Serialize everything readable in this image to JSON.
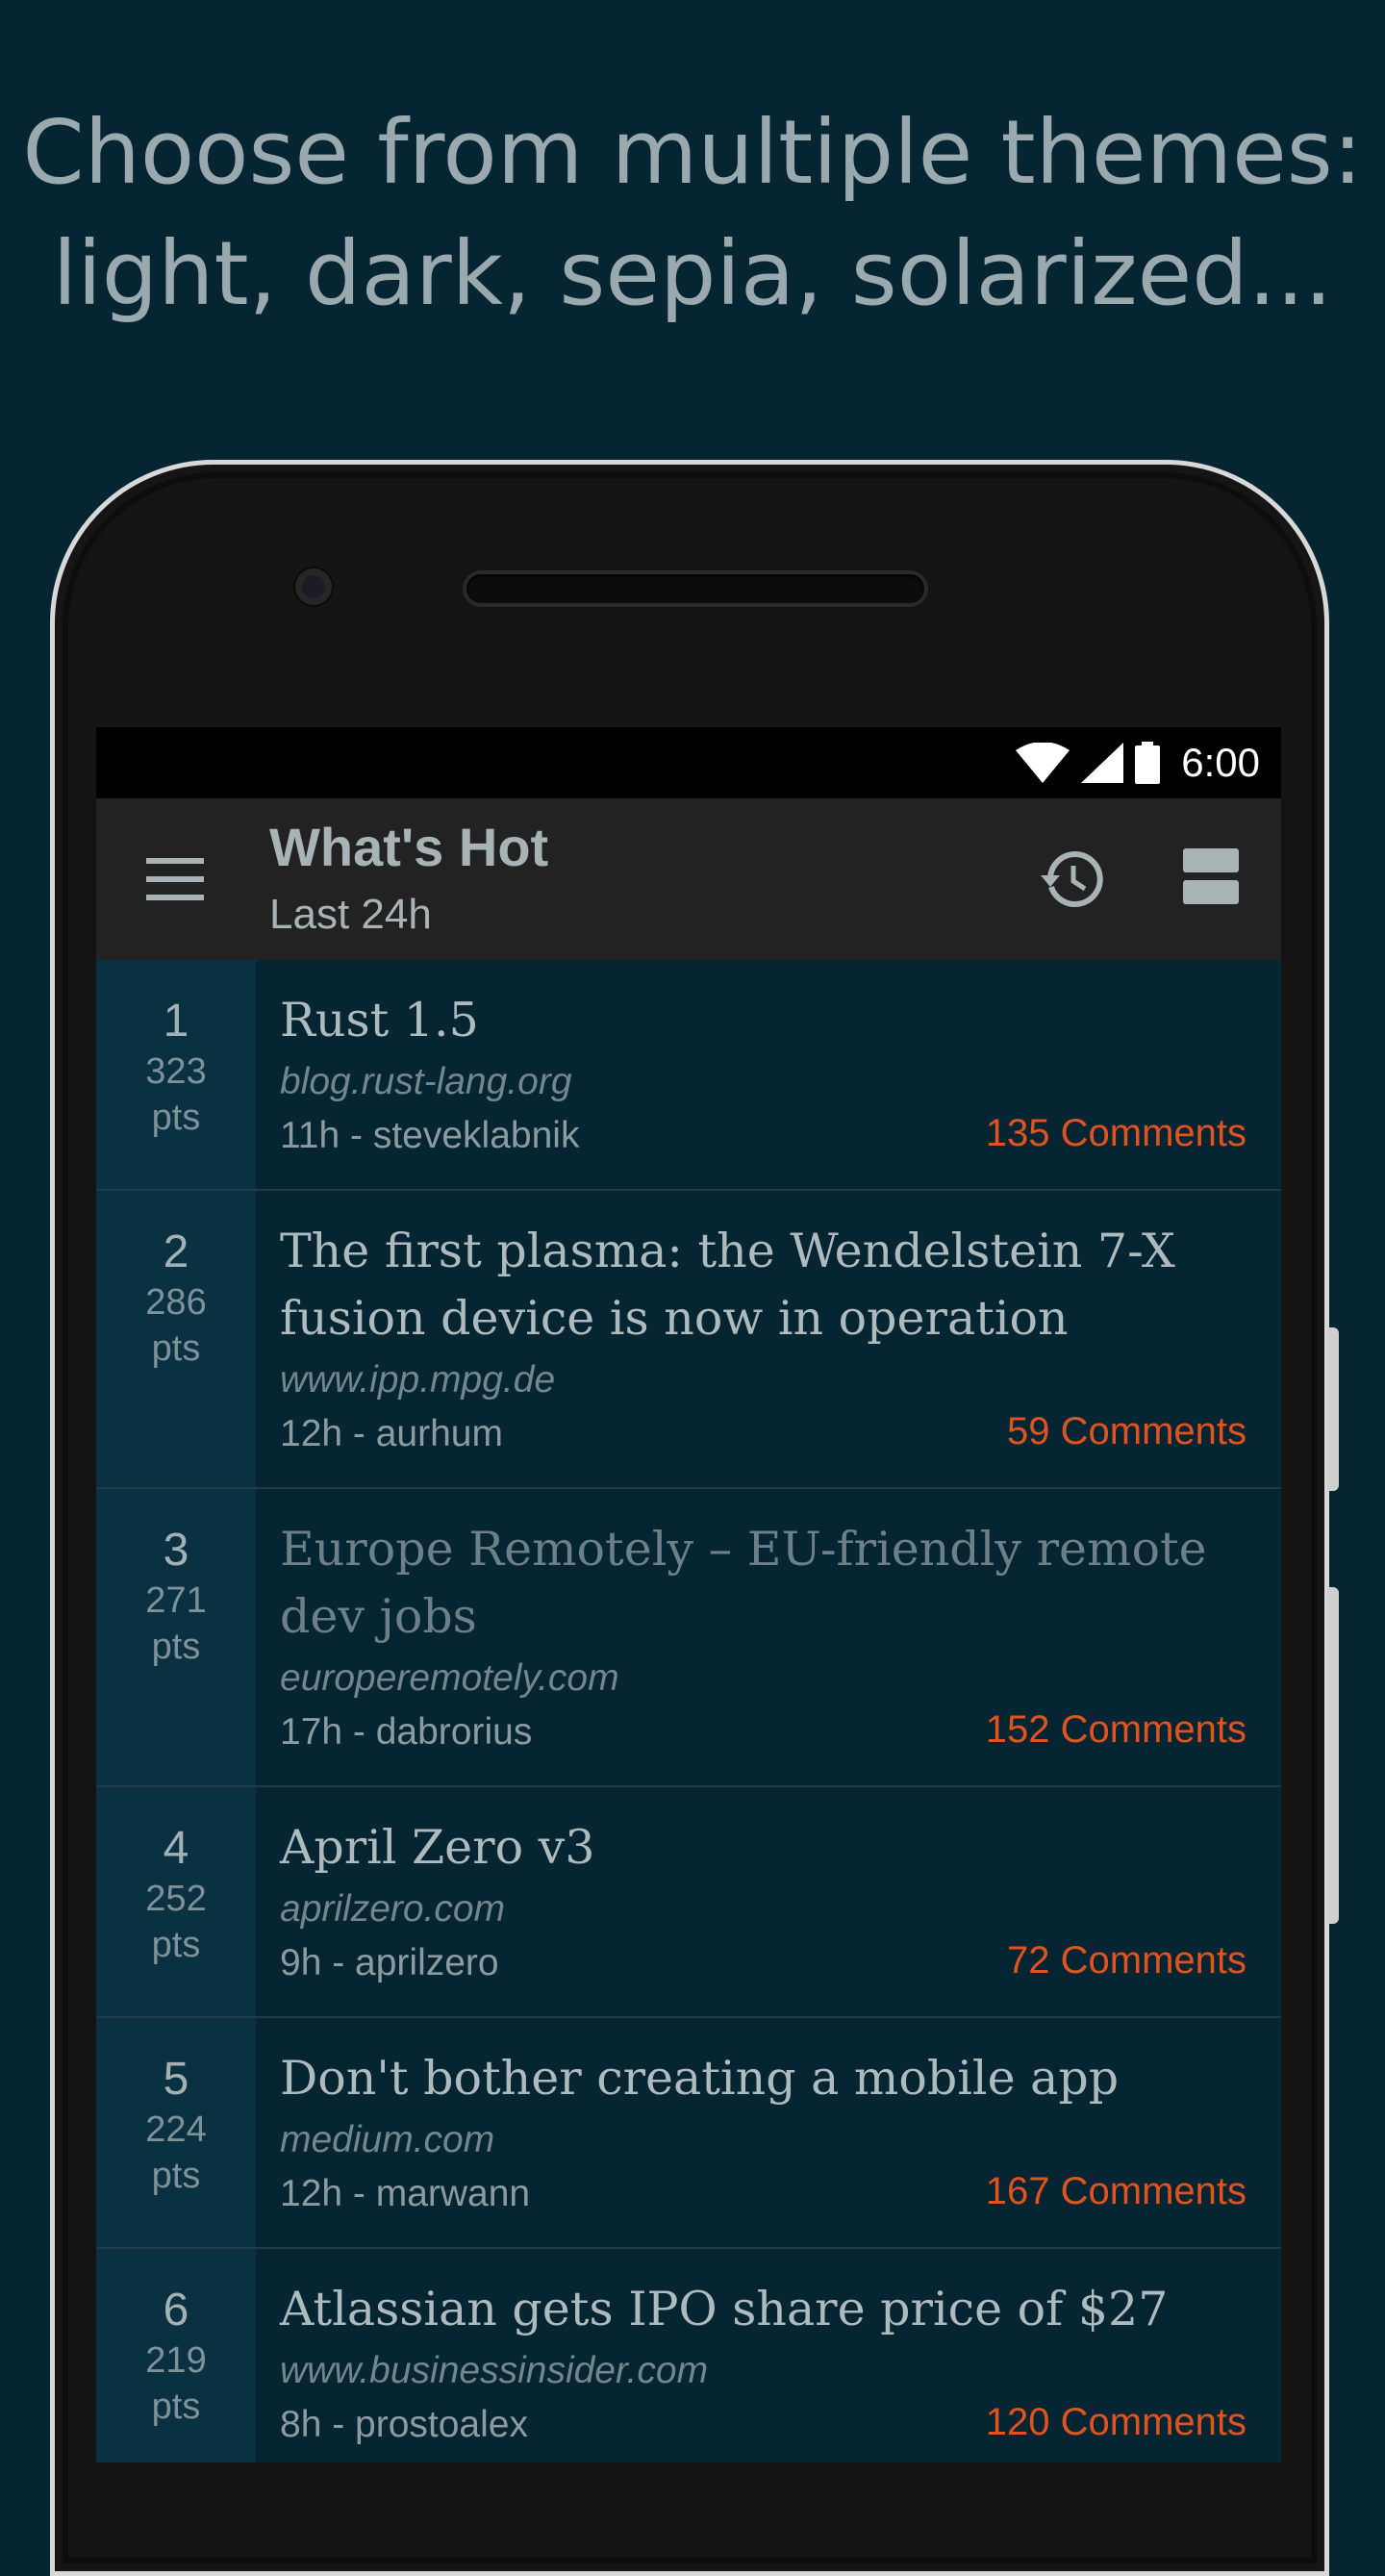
{
  "promo": {
    "line1": "Choose from multiple themes:",
    "line2": "light, dark, sepia, solarized..."
  },
  "status_bar": {
    "time": "6:00",
    "icons": [
      "wifi-icon",
      "cell-signal-icon",
      "battery-icon"
    ]
  },
  "app_bar": {
    "title": "What's Hot",
    "subtitle": "Last 24h",
    "menu_icon": "hamburger-menu-icon",
    "history_icon": "history-icon",
    "layout_icon": "view-layout-icon"
  },
  "colors": {
    "background": "#062532",
    "app_bar": "#222222",
    "accent_comments": "#e0531f",
    "rank_column": "#0a3142"
  },
  "stories": [
    {
      "rank": "1",
      "points": "323",
      "pts_label": "pts",
      "title_lines": [
        "Rust 1.5"
      ],
      "domain": "blog.rust-lang.org",
      "meta": "11h - steveklabnik",
      "comments": "135 Comments",
      "visited": false
    },
    {
      "rank": "2",
      "points": "286",
      "pts_label": "pts",
      "title_lines": [
        "The first plasma: the Wendelstein 7-X",
        "fusion device is now in operation"
      ],
      "domain": "www.ipp.mpg.de",
      "meta": "12h - aurhum",
      "comments": "59 Comments",
      "visited": false
    },
    {
      "rank": "3",
      "points": "271",
      "pts_label": "pts",
      "title_lines": [
        "Europe Remotely – EU-friendly remote",
        "dev jobs"
      ],
      "domain": "europeremotely.com",
      "meta": "17h - dabrorius",
      "comments": "152 Comments",
      "visited": true
    },
    {
      "rank": "4",
      "points": "252",
      "pts_label": "pts",
      "title_lines": [
        "April Zero v3"
      ],
      "domain": "aprilzero.com",
      "meta": "9h - aprilzero",
      "comments": "72 Comments",
      "visited": false
    },
    {
      "rank": "5",
      "points": "224",
      "pts_label": "pts",
      "title_lines": [
        "Don't bother creating a mobile app"
      ],
      "domain": "medium.com",
      "meta": "12h - marwann",
      "comments": "167 Comments",
      "visited": false
    },
    {
      "rank": "6",
      "points": "219",
      "pts_label": "pts",
      "title_lines": [
        "Atlassian gets IPO share price of $27"
      ],
      "domain": "www.businessinsider.com",
      "meta": "8h - prostoalex",
      "comments": "120 Comments",
      "visited": false
    }
  ]
}
